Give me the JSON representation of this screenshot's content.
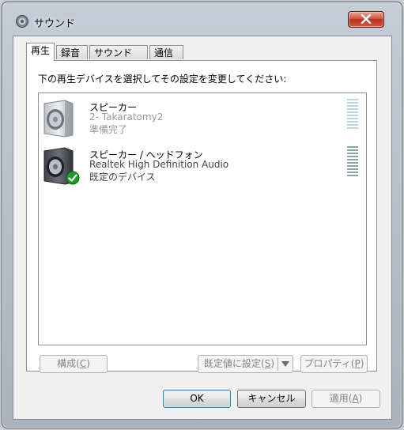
{
  "window": {
    "title": "サウンド"
  },
  "tabs": [
    {
      "label": "再生",
      "active": true
    },
    {
      "label": "録音",
      "active": false
    },
    {
      "label": "サウンド",
      "active": false
    },
    {
      "label": "通信",
      "active": false
    }
  ],
  "playback": {
    "instruction": "下の再生デバイスを選択してその設定を変更してください:",
    "devices": [
      {
        "name": "スピーカー",
        "line2": "2- Takaratomy2",
        "status": "準備完了",
        "selected": true,
        "default": false,
        "icon": "speaker-icon"
      },
      {
        "name": "スピーカー / ヘッドフォン",
        "line2": "Realtek High Definition Audio",
        "status": "既定のデバイス",
        "selected": false,
        "default": true,
        "icon": "speaker-icon"
      }
    ],
    "buttons": {
      "configure": {
        "label": "構成(",
        "key": "C",
        "suffix": ")"
      },
      "set_default": {
        "label": "既定値に設定(",
        "key": "S",
        "suffix": ")"
      },
      "properties": {
        "label": "プロパティ(",
        "key": "P",
        "suffix": ")"
      }
    }
  },
  "footer": {
    "ok": "OK",
    "cancel": "キャンセル",
    "apply": {
      "label": "適用(",
      "key": "A",
      "suffix": ")"
    }
  },
  "colors": {
    "meter_selected": "#b4d9e4",
    "meter_default": "#8fa3ad",
    "check": "#1f9a2c"
  }
}
